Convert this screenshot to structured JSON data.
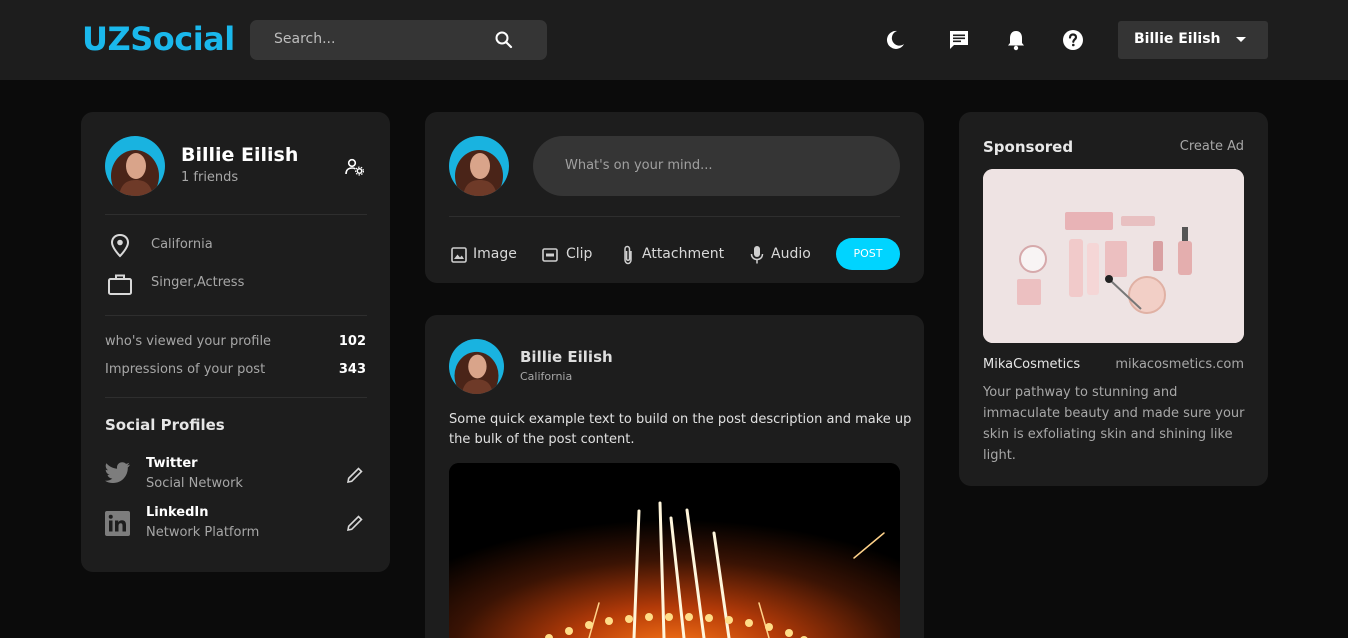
{
  "header": {
    "logo": "UZSocial",
    "search_placeholder": "Search...",
    "user_name": "Billie Eilish"
  },
  "profile": {
    "name": "Billie Eilish",
    "friends": "1 friends",
    "location": "California",
    "occupation": "Singer,Actress",
    "stats": [
      {
        "label": "who's viewed your profile",
        "value": "102"
      },
      {
        "label": "Impressions of your post",
        "value": "343"
      }
    ],
    "social_title": "Social Profiles",
    "socials": [
      {
        "name": "Twitter",
        "desc": "Social Network"
      },
      {
        "name": "LinkedIn",
        "desc": "Network Platform"
      }
    ]
  },
  "composer": {
    "placeholder": "What's on your mind...",
    "actions": [
      "Image",
      "Clip",
      "Attachment",
      "Audio"
    ],
    "post_label": "POST"
  },
  "post": {
    "author": "Billie Eilish",
    "location": "California",
    "text_line1": "Some quick example text to build on the post description and make up",
    "text_line2": "the bulk of the post content."
  },
  "sponsored": {
    "title": "Sponsored",
    "create_ad": "Create Ad",
    "brand": "MikaCosmetics",
    "url": "mikacosmetics.com",
    "desc_lines": [
      "Your pathway to stunning and",
      "immaculate beauty and made sure your",
      "skin is exfoliating skin and shining like",
      "light."
    ]
  },
  "colors": {
    "accent": "#1ab8ec",
    "post_button": "#00d4ff",
    "card": "#1d1d1d",
    "background": "#0b0b0b"
  }
}
